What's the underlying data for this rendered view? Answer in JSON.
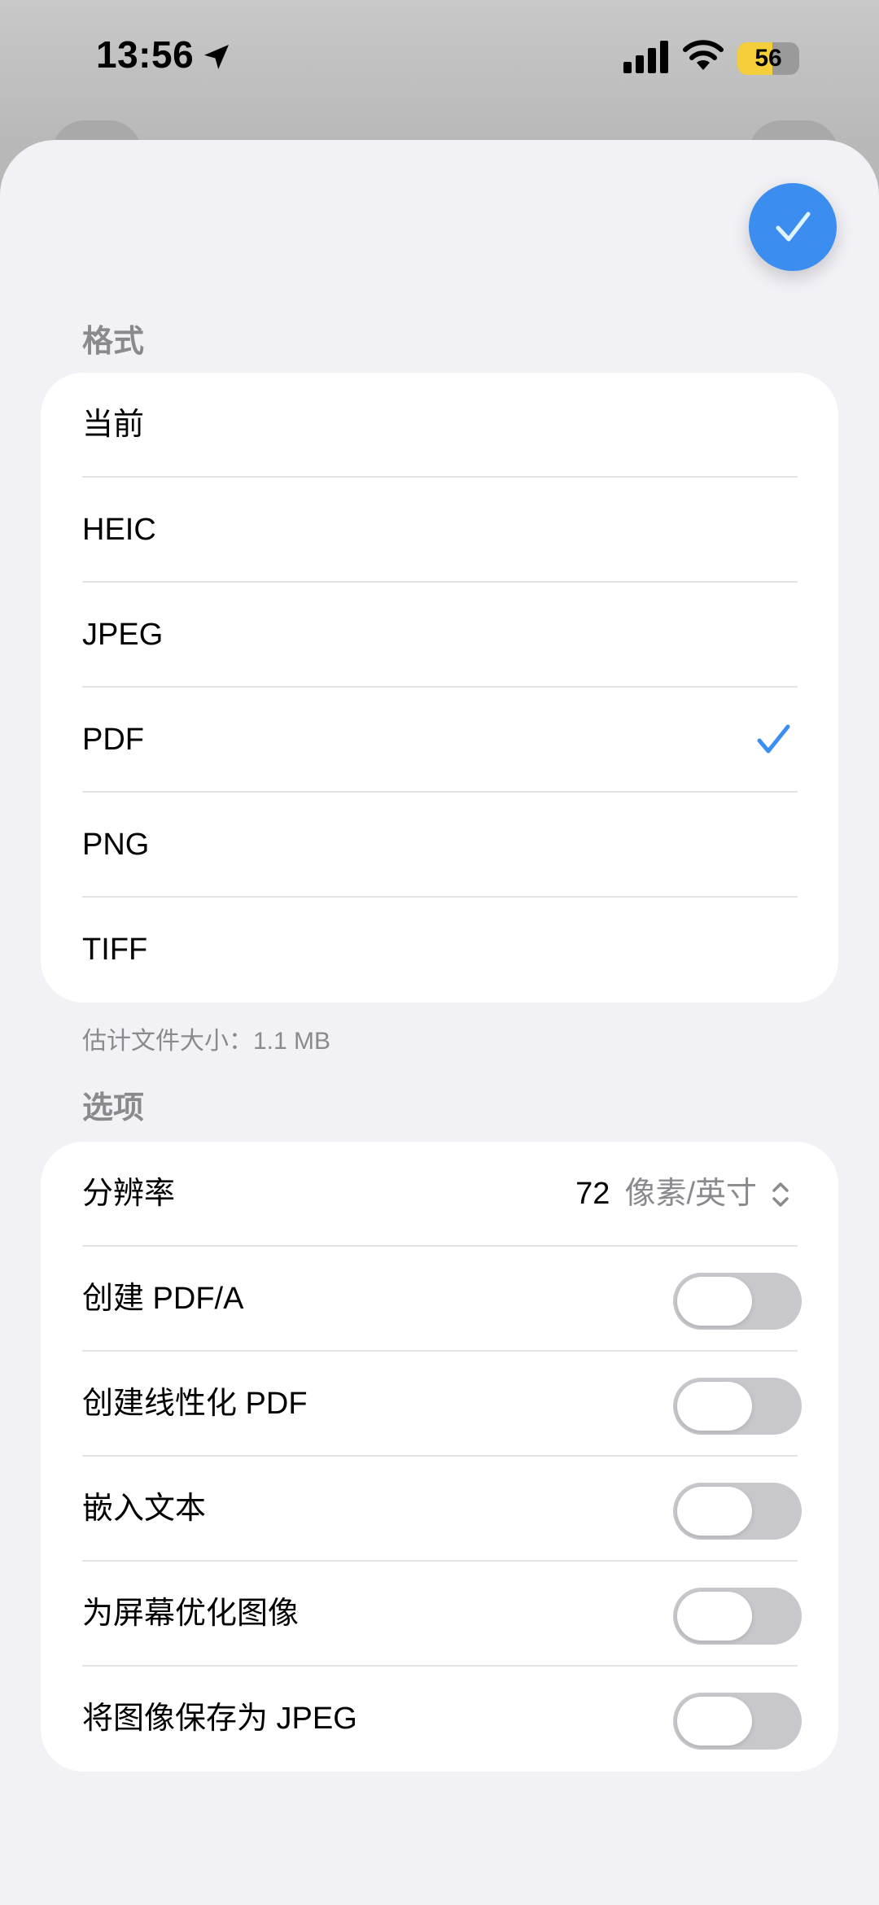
{
  "status": {
    "time": "13:56",
    "battery": "56",
    "battery_level": 0.56
  },
  "format_section": {
    "header": "格式",
    "items": [
      {
        "label": "当前",
        "selected": false
      },
      {
        "label": "HEIC",
        "selected": false
      },
      {
        "label": "JPEG",
        "selected": false
      },
      {
        "label": "PDF",
        "selected": true
      },
      {
        "label": "PNG",
        "selected": false
      },
      {
        "label": "TIFF",
        "selected": false
      }
    ],
    "estimate": "估计文件大小：1.1 MB"
  },
  "options_section": {
    "header": "选项",
    "resolution": {
      "label": "分辨率",
      "value": "72",
      "unit": "像素/英寸"
    },
    "toggles": [
      {
        "label": "创建 PDF/A",
        "on": false
      },
      {
        "label": "创建线性化 PDF",
        "on": false
      },
      {
        "label": "嵌入文本",
        "on": false
      },
      {
        "label": "为屏幕优化图像",
        "on": false
      },
      {
        "label": "将图像保存为 JPEG",
        "on": false
      }
    ]
  },
  "colors": {
    "accent": "#3b8ef0",
    "sheet": "#f1f1f6",
    "toggle_off": "#c7c7cc",
    "secondary_text": "#8a8a8e"
  },
  "icons": [
    "location-arrow-icon",
    "cellular-signal-icon",
    "wifi-icon",
    "battery-icon",
    "checkmark-icon",
    "chevron-up-down-icon"
  ]
}
